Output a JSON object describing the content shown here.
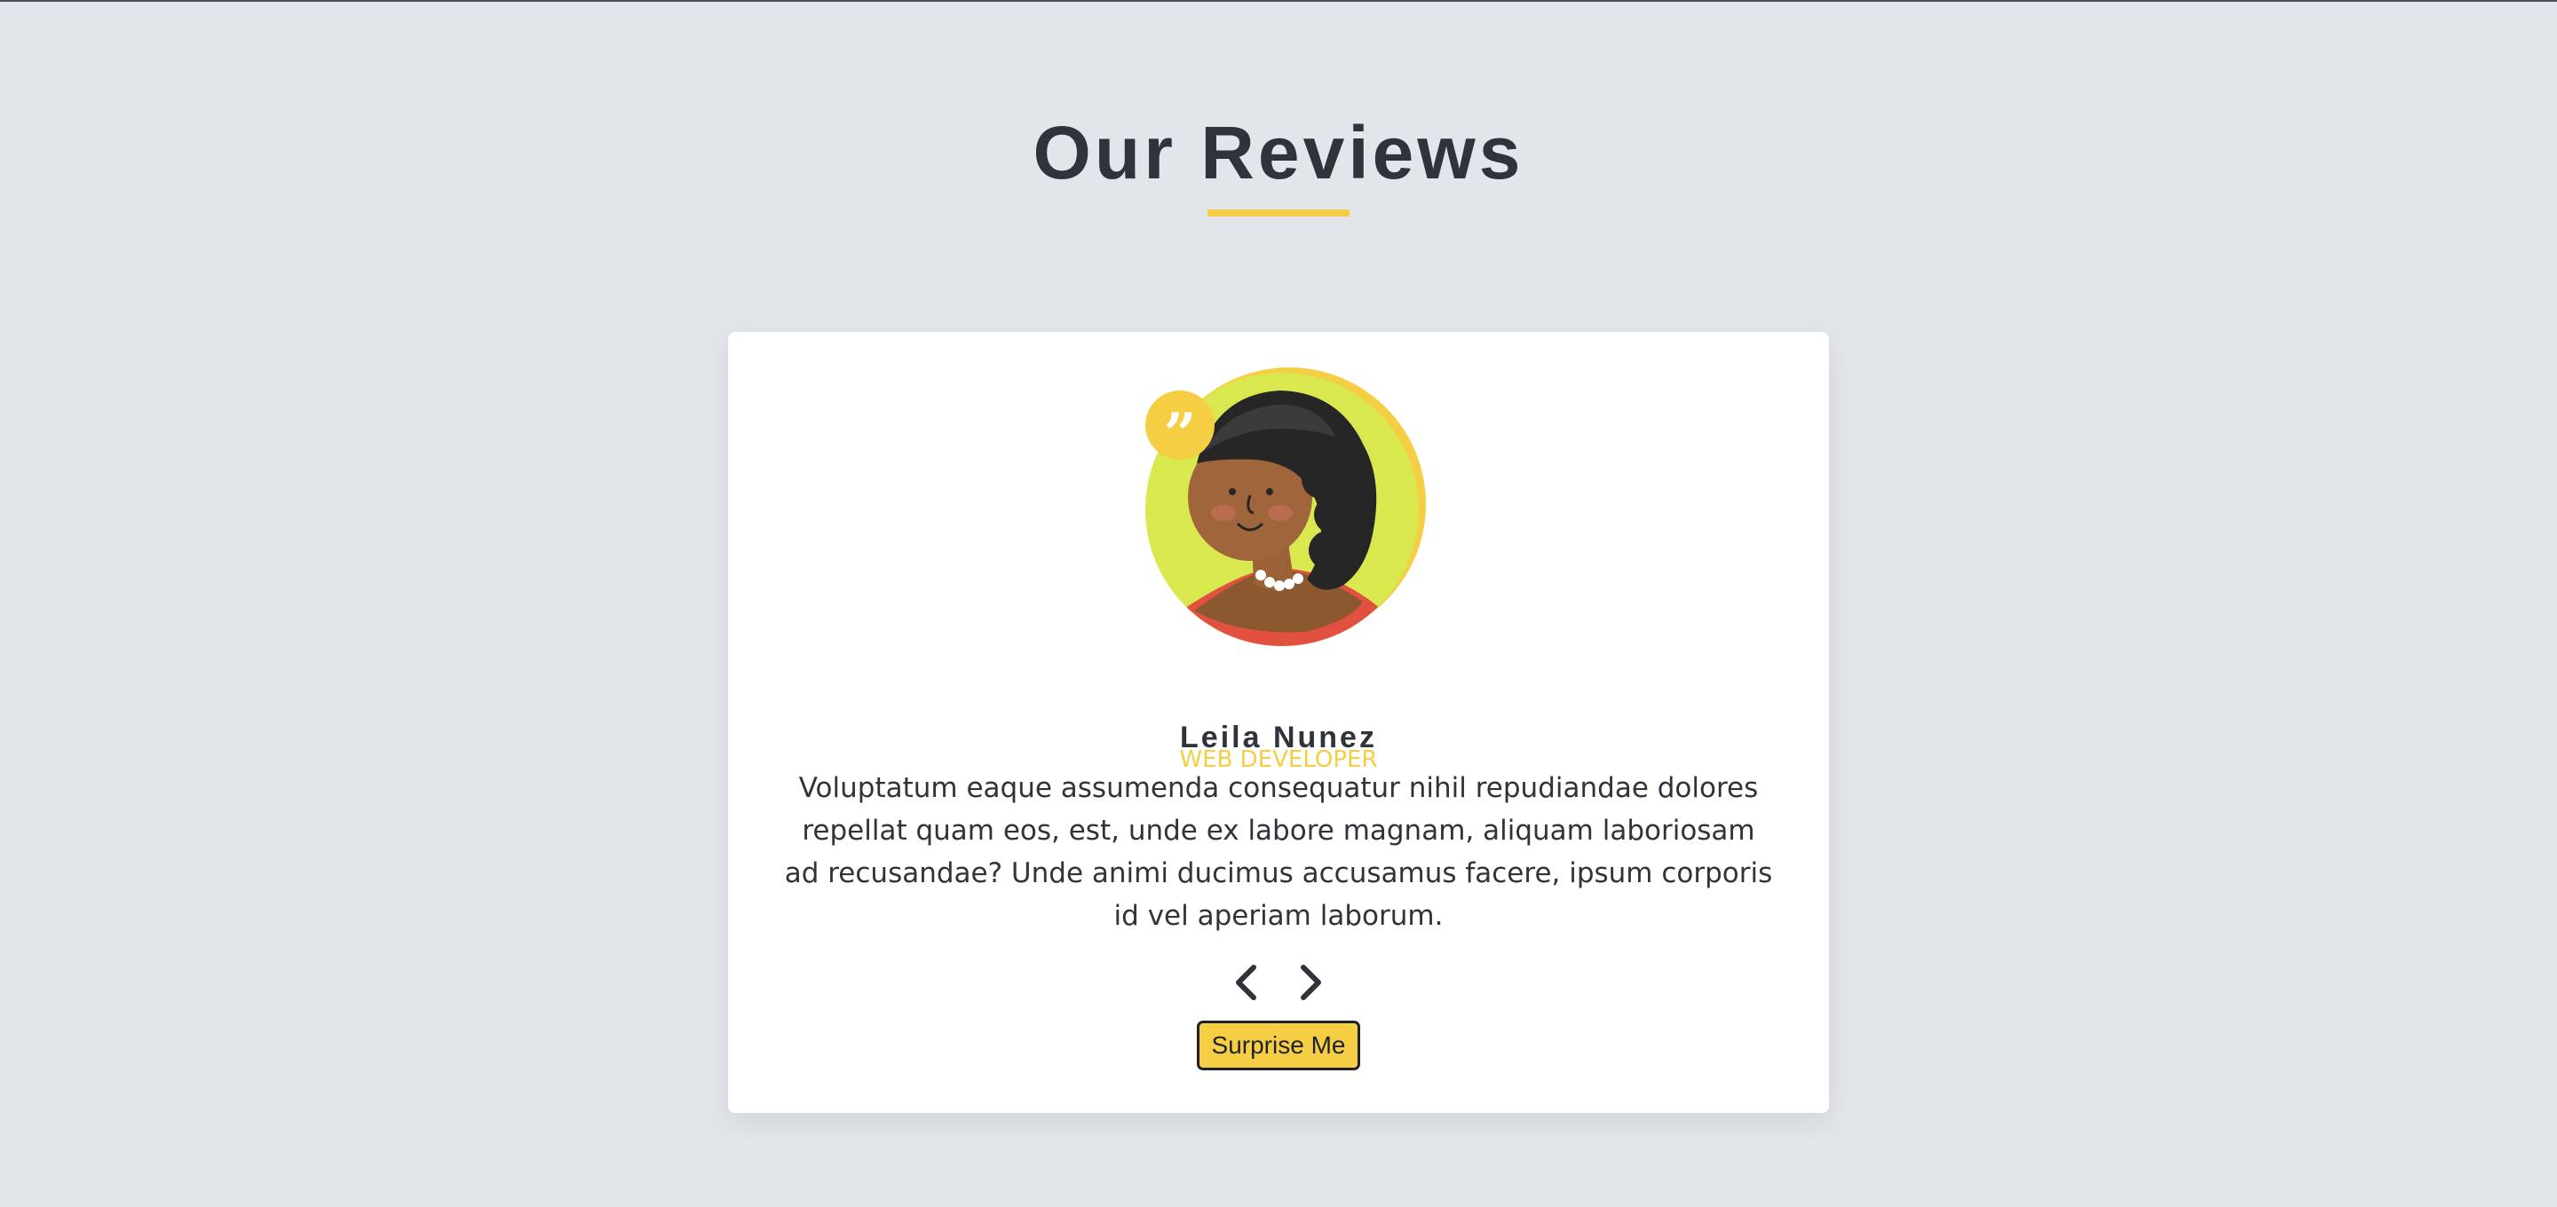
{
  "section": {
    "title": "Our Reviews"
  },
  "review": {
    "name": "Leila Nunez",
    "job": "Web Developer",
    "text": "Voluptatum eaque assumenda consequatur nihil repudiandae dolores repellat quam eos, est, unde ex labore magnam, aliquam laboriosam ad recusandae? Unde animi ducimus accusamus facere, ipsum corporis id vel aperiam laborum.",
    "quote_glyph": "”"
  },
  "controls": {
    "prev_icon": "chevron-left-icon",
    "next_icon": "chevron-right-icon",
    "random_label": "Surprise Me"
  },
  "colors": {
    "background": "#e2e6ea",
    "accent": "#f6ce43",
    "text": "#2f343b",
    "card": "#ffffff"
  }
}
